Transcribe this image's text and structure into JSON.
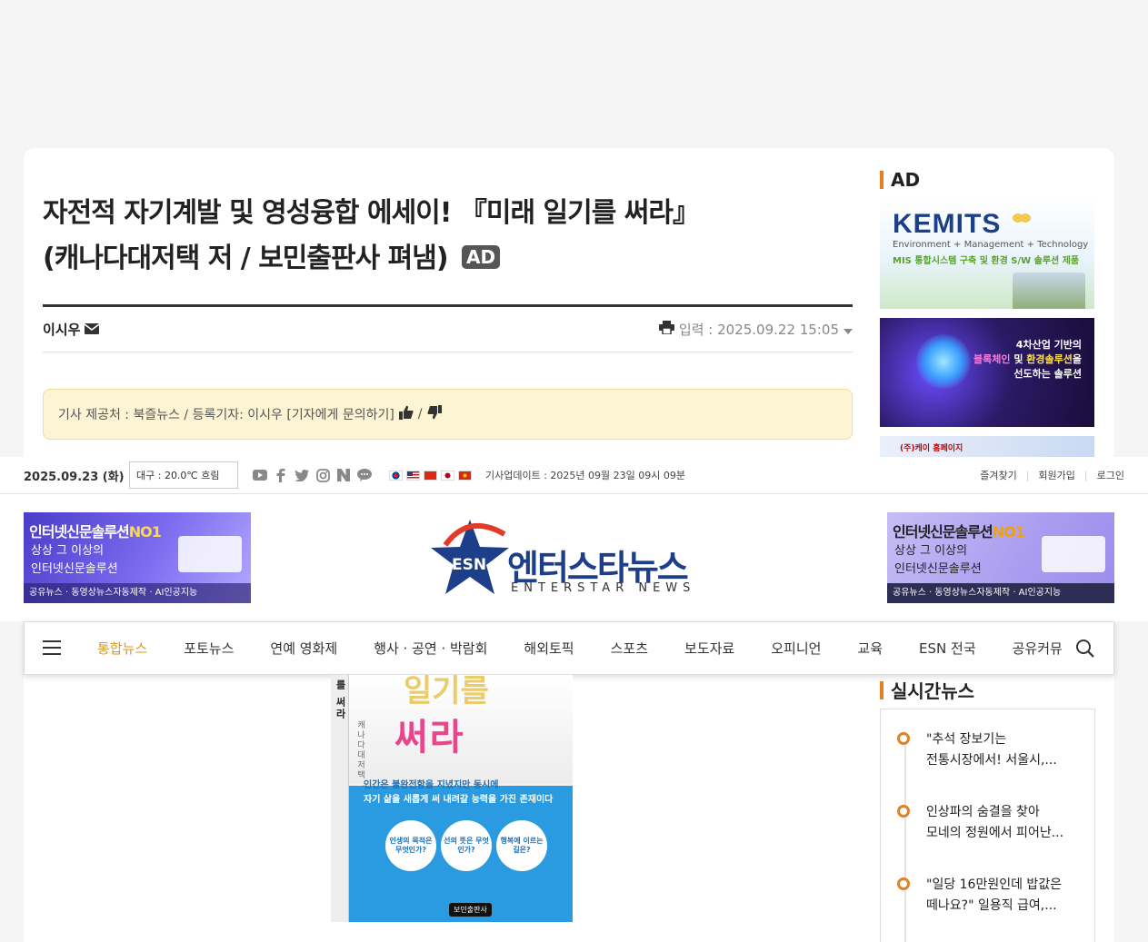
{
  "article": {
    "title_line1": "자전적 자기계발 및 영성융합 에세이! 『미래 일기를 써라』",
    "title_line2": "(캐나다대저택 저 / 보민출판사 펴냄)",
    "ad_badge": "AD",
    "author": "이시우",
    "date_label": "입력 : 2025.09.22 15:05",
    "source_text": "기사 제공처 : 북즐뉴스 / 등록기자: 이시우 [기자에게 문의하기]",
    "source_sep": "/"
  },
  "ad_section": {
    "title": "AD",
    "kemits": {
      "brand": "KEMITS",
      "sub1": "Environment + Management + Technology",
      "sub2": "MIS 통합시스템 구축 및 환경 S/W 솔루션 제품"
    },
    "solution": {
      "line1": "4차산업 기반의",
      "line2_a": "블록체인",
      "line2_b": " 및 ",
      "line2_c": "환경솔루션",
      "line2_d": "을",
      "line3": "선도하는 솔루션"
    },
    "homepage": "(주)케이 홈페이지"
  },
  "topbar": {
    "date": "2025.09.23 (화)",
    "weather": "대구 : 20.0℃ 흐림",
    "update": "기사업데이트 : 2025년 09월 23일 09시 09분",
    "links": [
      "즐겨찾기",
      "회원가입",
      "로그인"
    ]
  },
  "header": {
    "banner": {
      "line1": "인터넷신문솔루션",
      "no1": "NO1",
      "line2": "상상 그 이상의",
      "line3": "인터넷신문솔루션",
      "line4": "공유뉴스 · 동영상뉴스자동제작 · AI인공지능"
    },
    "logo_esn": "ESN",
    "logo_korean": "엔터스타뉴스",
    "logo_english": "ENTERSTAR NEWS"
  },
  "nav": {
    "items": [
      "통합뉴스",
      "포토뉴스",
      "연예 영화제",
      "행사 · 공연 · 박람회",
      "해외토픽",
      "스포츠",
      "보도자료",
      "오피니언",
      "교육",
      "ESN 전국",
      "공유커뮤"
    ]
  },
  "book": {
    "spine": "를 써라",
    "title": "써라",
    "title_top": "일기를",
    "author": "캐나다대저택 지음",
    "tagline1": "인간은 불완전함을 지녔지만 동시에",
    "tagline2": "자기 삶을 새롭게 써 내려갈 능력을 가진 존재이다",
    "q1": "인생의 목적은 무엇인가?",
    "q2": "선의 뜻은 무엇인가?",
    "q3": "행복에 이르는 길은?",
    "publisher": "보민출판사"
  },
  "realtime": {
    "title": "실시간뉴스",
    "items": [
      {
        "line1": "\"추석 장보기는",
        "line2": "전통시장에서! 서울시,..."
      },
      {
        "line1": "인상파의 숨결을 찾아",
        "line2": "모네의 정원에서 피어난..."
      },
      {
        "line1": "\"일당 16만원인데 밥값은",
        "line2": "떼나요?\" 일용직 급여,..."
      }
    ]
  },
  "colors": {
    "accent_orange": "#e67e22",
    "nav_active": "#d99a1e",
    "brand_navy": "#1d3f8a",
    "source_box_bg": "#fdf4d3"
  }
}
